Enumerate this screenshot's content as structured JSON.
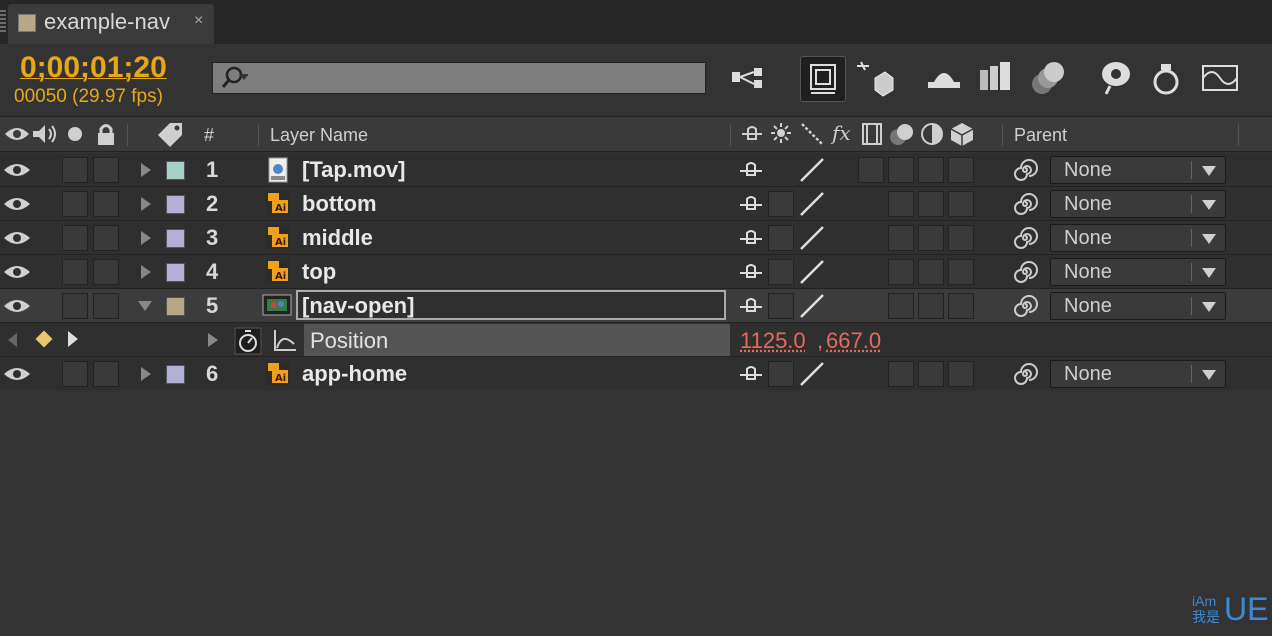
{
  "tab": {
    "title": "example-nav",
    "close": "×",
    "swatch_color": "#b8a889"
  },
  "toolbar": {
    "timecode": "0;00;01;20",
    "fps_info": "00050 (29.97 fps)",
    "search_placeholder": ""
  },
  "header": {
    "hash": "#",
    "layer_name": "Layer Name",
    "parent": "Parent"
  },
  "layers": [
    {
      "num": "1",
      "name": "[Tap.mov]",
      "icon": "video-file-icon",
      "label_color": "#a7cfc6",
      "parent": "None"
    },
    {
      "num": "2",
      "name": "bottom",
      "icon": "illustrator-file-icon",
      "label_color": "#b3b0d6",
      "parent": "None"
    },
    {
      "num": "3",
      "name": "middle",
      "icon": "illustrator-file-icon",
      "label_color": "#b3b0d6",
      "parent": "None"
    },
    {
      "num": "4",
      "name": "top",
      "icon": "illustrator-file-icon",
      "label_color": "#b3b0d6",
      "parent": "None"
    },
    {
      "num": "5",
      "name": "[nav-open]",
      "icon": "composition-icon",
      "label_color": "#b8a889",
      "parent": "None"
    },
    {
      "num": "6",
      "name": "app-home",
      "icon": "illustrator-file-icon",
      "label_color": "#b3b0d6",
      "parent": "None"
    }
  ],
  "property": {
    "name": "Position",
    "value_x": "1125.0",
    "comma": ",",
    "value_y": "667.0",
    "value_color": "#e66a5e"
  },
  "watermark": {
    "small_top": "iAm",
    "small_bottom": "我是",
    "big": "UE"
  },
  "colors": {
    "accent": "#e6a817",
    "bg": "#333333"
  }
}
